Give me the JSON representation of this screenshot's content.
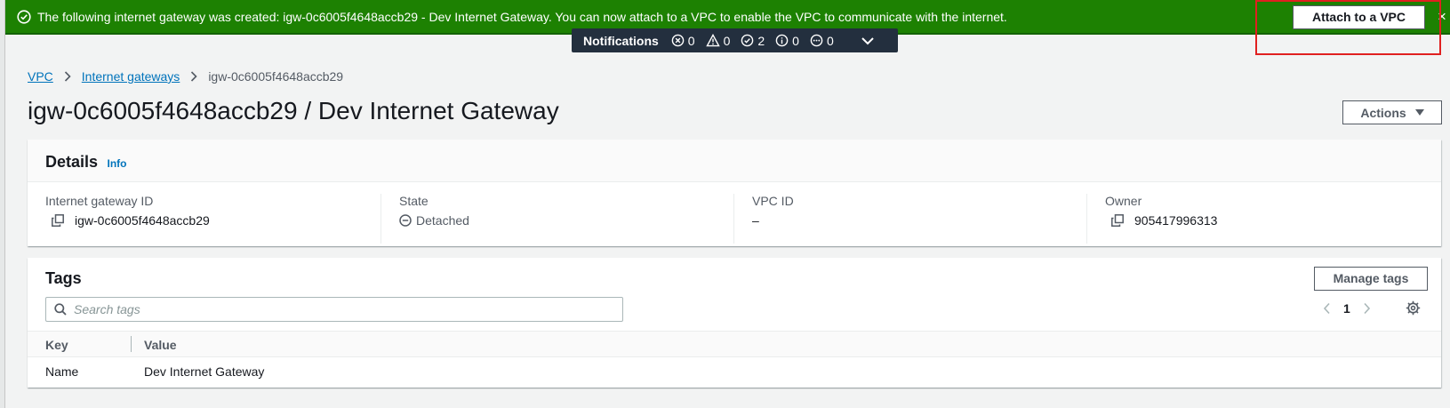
{
  "flash": {
    "message": "The following internet gateway was created: igw-0c6005f4648accb29 - Dev Internet Gateway. You can now attach to a VPC to enable the VPC to communicate with the internet.",
    "attach_label": "Attach to a VPC",
    "close_glyph": "×",
    "color": "#1d8102"
  },
  "notifications": {
    "title": "Notifications",
    "error_count": "0",
    "warning_count": "0",
    "success_count": "2",
    "info_count": "0",
    "in_progress_count": "0"
  },
  "breadcrumb": {
    "items": [
      "VPC",
      "Internet gateways"
    ],
    "current": "igw-0c6005f4648accb29"
  },
  "page": {
    "title": "igw-0c6005f4648accb29 / Dev Internet Gateway",
    "actions_label": "Actions"
  },
  "details": {
    "title": "Details",
    "info_label": "Info",
    "fields": [
      {
        "label": "Internet gateway ID",
        "value": "igw-0c6005f4648accb29",
        "icon": "copy-icon"
      },
      {
        "label": "State",
        "value": "Detached",
        "icon": "detached-icon"
      },
      {
        "label": "VPC ID",
        "value": "–"
      },
      {
        "label": "Owner",
        "value": "905417996313",
        "icon": "copy-icon"
      }
    ]
  },
  "tags": {
    "title": "Tags",
    "manage_label": "Manage tags",
    "search_placeholder": "Search tags",
    "page": "1",
    "columns": [
      "Key",
      "Value"
    ],
    "rows": [
      {
        "key": "Name",
        "value": "Dev Internet Gateway"
      }
    ]
  }
}
